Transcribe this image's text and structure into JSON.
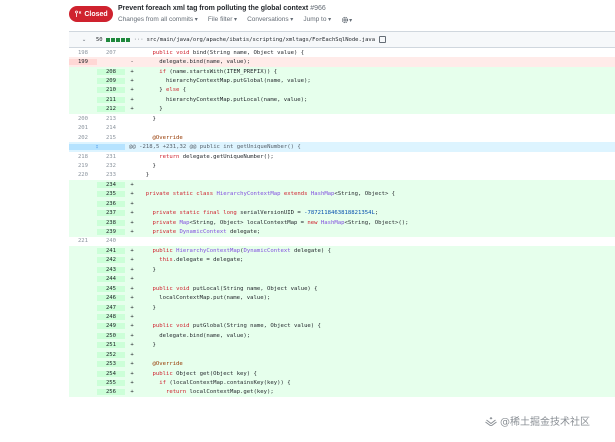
{
  "pr": {
    "state": "Closed",
    "title": "Prevent foreach xml tag from polluting the global context",
    "number": "#966",
    "nav": [
      "Changes from all commits",
      "File filter",
      "Conversations",
      "Jump to"
    ]
  },
  "file": {
    "change_count": "50",
    "path": "src/main/java/org/apache/ibatis/scripting/xmltags/ForEachSqlNode.java"
  },
  "hunk2": "@@ -218,5 +231,32 @@ public int getUniqueNumber() {",
  "lines": [
    {
      "t": "ctx",
      "o": "198",
      "n": "207",
      "m": "",
      "c": "    public void bind(String name, Object value) {"
    },
    {
      "t": "del",
      "o": "199",
      "n": "",
      "m": "-",
      "c": "      delegate.bind(name, value);"
    },
    {
      "t": "add",
      "o": "",
      "n": "208",
      "m": "+",
      "c": "      if (name.startsWith(ITEM_PREFIX)) {"
    },
    {
      "t": "add",
      "o": "",
      "n": "209",
      "m": "+",
      "c": "        hierarchyContextMap.putGlobal(name, value);"
    },
    {
      "t": "add",
      "o": "",
      "n": "210",
      "m": "+",
      "c": "      } else {"
    },
    {
      "t": "add",
      "o": "",
      "n": "211",
      "m": "+",
      "c": "        hierarchyContextMap.putLocal(name, value);"
    },
    {
      "t": "add",
      "o": "",
      "n": "212",
      "m": "+",
      "c": "      }"
    },
    {
      "t": "ctx",
      "o": "200",
      "n": "213",
      "m": "",
      "c": "    }"
    },
    {
      "t": "ctx",
      "o": "201",
      "n": "214",
      "m": "",
      "c": ""
    },
    {
      "t": "ctx",
      "o": "202",
      "n": "215",
      "m": "",
      "c": "    @Override"
    },
    {
      "t": "hunk",
      "o": "",
      "n": "",
      "m": "",
      "c": ""
    },
    {
      "t": "ctx",
      "o": "218",
      "n": "231",
      "m": "",
      "c": "      return delegate.getUniqueNumber();"
    },
    {
      "t": "ctx",
      "o": "219",
      "n": "232",
      "m": "",
      "c": "    }"
    },
    {
      "t": "ctx",
      "o": "220",
      "n": "233",
      "m": "",
      "c": "  }"
    },
    {
      "t": "add",
      "o": "",
      "n": "234",
      "m": "+",
      "c": ""
    },
    {
      "t": "add",
      "o": "",
      "n": "235",
      "m": "+",
      "c": "  private static class HierarchyContextMap extends HashMap<String, Object> {"
    },
    {
      "t": "add",
      "o": "",
      "n": "236",
      "m": "+",
      "c": ""
    },
    {
      "t": "add",
      "o": "",
      "n": "237",
      "m": "+",
      "c": "    private static final long serialVersionUID = -7872118463818821354L;"
    },
    {
      "t": "add",
      "o": "",
      "n": "238",
      "m": "+",
      "c": "    private Map<String, Object> localContextMap = new HashMap<String, Object>();"
    },
    {
      "t": "add",
      "o": "",
      "n": "239",
      "m": "+",
      "c": "    private DynamicContext delegate;"
    },
    {
      "t": "ctx",
      "o": "221",
      "n": "240",
      "m": "",
      "c": ""
    },
    {
      "t": "add",
      "o": "",
      "n": "241",
      "m": "+",
      "c": "    public HierarchyContextMap(DynamicContext delegate) {"
    },
    {
      "t": "add",
      "o": "",
      "n": "242",
      "m": "+",
      "c": "      this.delegate = delegate;"
    },
    {
      "t": "add",
      "o": "",
      "n": "243",
      "m": "+",
      "c": "    }"
    },
    {
      "t": "add",
      "o": "",
      "n": "244",
      "m": "+",
      "c": ""
    },
    {
      "t": "add",
      "o": "",
      "n": "245",
      "m": "+",
      "c": "    public void putLocal(String name, Object value) {"
    },
    {
      "t": "add",
      "o": "",
      "n": "246",
      "m": "+",
      "c": "      localContextMap.put(name, value);"
    },
    {
      "t": "add",
      "o": "",
      "n": "247",
      "m": "+",
      "c": "    }"
    },
    {
      "t": "add",
      "o": "",
      "n": "248",
      "m": "+",
      "c": ""
    },
    {
      "t": "add",
      "o": "",
      "n": "249",
      "m": "+",
      "c": "    public void putGlobal(String name, Object value) {"
    },
    {
      "t": "add",
      "o": "",
      "n": "250",
      "m": "+",
      "c": "      delegate.bind(name, value);"
    },
    {
      "t": "add",
      "o": "",
      "n": "251",
      "m": "+",
      "c": "    }"
    },
    {
      "t": "add",
      "o": "",
      "n": "252",
      "m": "+",
      "c": ""
    },
    {
      "t": "add",
      "o": "",
      "n": "253",
      "m": "+",
      "c": "    @Override"
    },
    {
      "t": "add",
      "o": "",
      "n": "254",
      "m": "+",
      "c": "    public Object get(Object key) {"
    },
    {
      "t": "add",
      "o": "",
      "n": "255",
      "m": "+",
      "c": "      if (localContextMap.containsKey(key)) {"
    },
    {
      "t": "add",
      "o": "",
      "n": "256",
      "m": "+",
      "c": "        return localContextMap.get(key);"
    }
  ],
  "watermark": "@稀土掘金技术社区",
  "colors": {
    "closed": "#cf222e",
    "add_bg": "#e6ffec",
    "del_bg": "#ffebe9",
    "hunk_bg": "#ddf4ff"
  }
}
